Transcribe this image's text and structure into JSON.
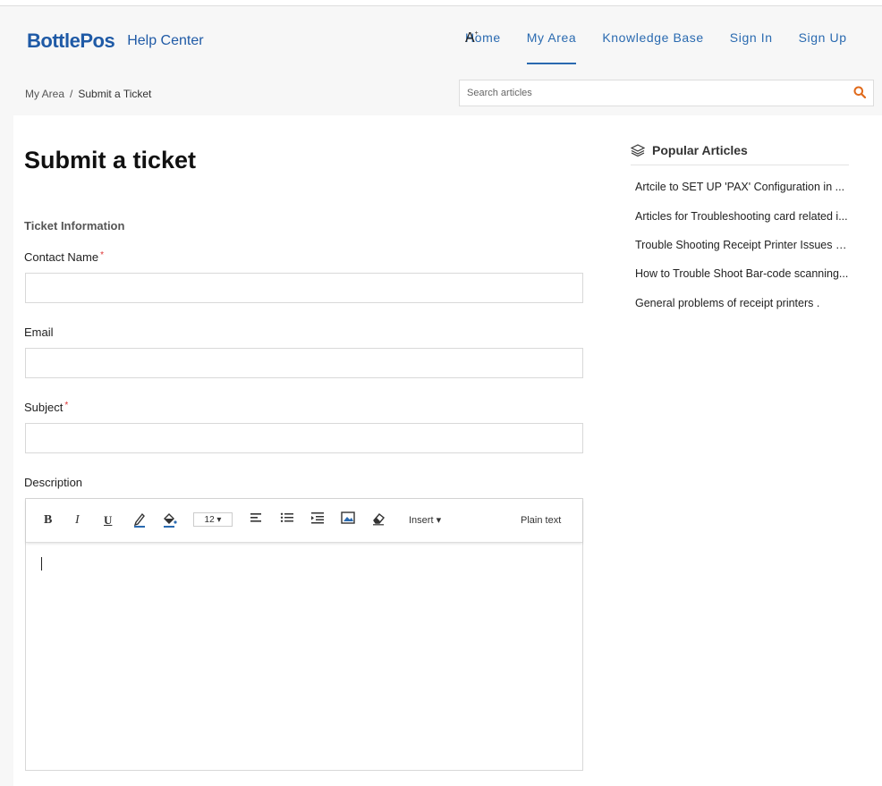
{
  "brand": {
    "logo_text": "BottlePos",
    "subtitle": "Help Center",
    "color": "#1f5aa6"
  },
  "nav": {
    "items": [
      {
        "label": "Home"
      },
      {
        "label": "My Area"
      },
      {
        "label": "Knowledge Base"
      },
      {
        "label": "Sign In"
      },
      {
        "label": "Sign Up"
      }
    ],
    "active": "My Area",
    "font_size_icon": "A"
  },
  "breadcrumb": {
    "parent": "My Area",
    "separator": "/",
    "current": "Submit a Ticket"
  },
  "search": {
    "placeholder": "Search articles",
    "icon": "search-icon",
    "icon_color": "#e06a1b"
  },
  "form": {
    "title": "Submit a ticket",
    "section": "Ticket Information",
    "contact_name": {
      "label": "Contact Name",
      "required_mark": "*",
      "value": ""
    },
    "email": {
      "label": "Email",
      "value": ""
    },
    "subject": {
      "label": "Subject",
      "required_mark": "*",
      "value": ""
    },
    "description": {
      "label": "Description",
      "toolbar": {
        "bold": "B",
        "italic": "I",
        "underline": "U",
        "font_size": "12 ▾",
        "insert": "Insert ▾",
        "plain_text": "Plain text"
      },
      "value": ""
    }
  },
  "sidebar": {
    "heading": "Popular Articles",
    "articles": [
      "Artcile to SET UP 'PAX' Configuration in ...",
      "Articles for Troubleshooting card related i...",
      "Trouble Shooting Receipt Printer Issues a...",
      "How to Trouble Shoot Bar-code scanning...",
      "General problems of receipt printers ."
    ]
  }
}
